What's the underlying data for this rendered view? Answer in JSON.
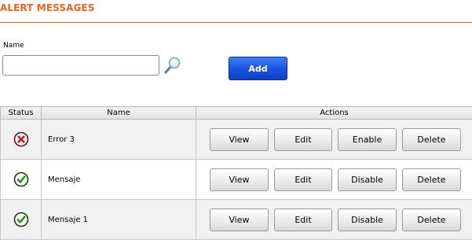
{
  "page": {
    "title": "ALERT MESSAGES"
  },
  "form": {
    "name_label": "Name",
    "name_value": "",
    "add_label": "Add"
  },
  "table": {
    "headers": {
      "status": "Status",
      "name": "Name",
      "actions": "Actions"
    },
    "rows": [
      {
        "status": "disabled",
        "status_icon": "error-x-icon",
        "name": "Error 3",
        "view_label": "View",
        "edit_label": "Edit",
        "toggle_label": "Enable",
        "delete_label": "Delete"
      },
      {
        "status": "enabled",
        "status_icon": "check-icon",
        "name": "Mensaje",
        "view_label": "View",
        "edit_label": "Edit",
        "toggle_label": "Disable",
        "delete_label": "Delete"
      },
      {
        "status": "enabled",
        "status_icon": "check-icon",
        "name": "Mensaje 1",
        "view_label": "View",
        "edit_label": "Edit",
        "toggle_label": "Disable",
        "delete_label": "Delete"
      }
    ]
  },
  "colors": {
    "accent": "#e8641e",
    "primary_button": "#1d55e0",
    "enabled_status": "#2a8a1e",
    "disabled_status": "#b01e1e"
  }
}
